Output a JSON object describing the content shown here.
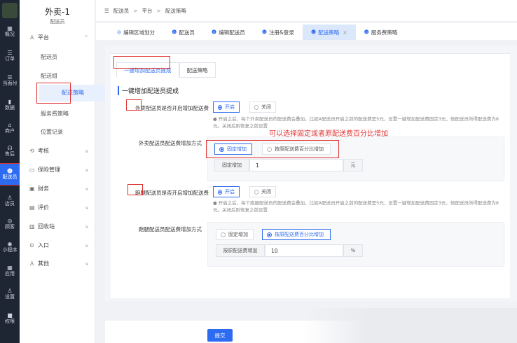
{
  "rail": {
    "items": [
      {
        "label": "概况",
        "icon": "▦"
      },
      {
        "label": "订单",
        "icon": "☰"
      },
      {
        "label": "当面付",
        "icon": "☰"
      },
      {
        "label": "数据",
        "icon": "▮"
      },
      {
        "label": "商户",
        "icon": "⌂"
      },
      {
        "label": "售后",
        "icon": "☊"
      },
      {
        "label": "配送员",
        "icon": "☻"
      },
      {
        "label": "店员",
        "icon": "♙"
      },
      {
        "label": "顾客",
        "icon": "◎"
      },
      {
        "label": "小程序",
        "icon": "◉"
      },
      {
        "label": "应用",
        "icon": "▦"
      },
      {
        "label": "设置",
        "icon": "♙"
      },
      {
        "label": "权限",
        "icon": "■"
      }
    ]
  },
  "sidebar": {
    "title": "外卖-1",
    "subtitle": "配送员",
    "groups": [
      {
        "label": "平台",
        "icon": "♙",
        "arrow": "^"
      },
      {
        "label": "考核",
        "icon": "⟲",
        "arrow": "v"
      },
      {
        "label": "保险管理",
        "icon": "▭",
        "arrow": "v"
      },
      {
        "label": "财务",
        "icon": "▣",
        "arrow": "v"
      },
      {
        "label": "评价",
        "icon": "▤",
        "arrow": "v"
      },
      {
        "label": "回收站",
        "icon": "▥",
        "arrow": "v"
      },
      {
        "label": "入口",
        "icon": "⊙",
        "arrow": "v"
      },
      {
        "label": "其他",
        "icon": "♙",
        "arrow": "v"
      }
    ],
    "subitems": [
      "配送员",
      "配送组",
      "配送策略",
      "服务费策略",
      "位置记录"
    ]
  },
  "breadcrumb": {
    "menu_icon": "☰",
    "items": [
      "配送员",
      "平台",
      "配送策略"
    ],
    "sep": ">"
  },
  "tabs": [
    {
      "label": "编辑区域划分",
      "icon": "◎"
    },
    {
      "label": "配送员",
      "icon": "☻"
    },
    {
      "label": "编辑配送员",
      "icon": "☻"
    },
    {
      "label": "注册&登录",
      "icon": "☻"
    },
    {
      "label": "配送策略",
      "icon": "☻",
      "close": "×"
    },
    {
      "label": "服务费策略",
      "icon": "☻"
    }
  ],
  "subtabs": [
    "一键增加配送员提成",
    "配送策略"
  ],
  "section_title": "一键增加配送员提成",
  "takeaway": {
    "enable_label": "外卖配送员是否开启增加配送费",
    "on": "开启",
    "off": "关闭",
    "hint": "开启之后，每个外卖配送员的配送费会叠加，比如A配送员开启之前的配送费是5元，设置一键增加配送费固定3元，他配送员所得配送费为8元。关闭后则恢复之前设置",
    "mode_label": "外卖配送员配送费增加方式",
    "mode_fixed": "固定增加",
    "mode_percent": "按原配送费百分比增加",
    "amount_label": "固定增加",
    "amount_value": "1",
    "amount_unit": "元"
  },
  "errand": {
    "enable_label": "跑腿配送员是否开启增加配送费",
    "on": "开启",
    "off": "关闭",
    "hint": "开启之后，每个跑腿配送员的配送费会叠加，比如A配送员开启之前的配送费是5元，设置一键增加配送费固定3元，他配送员所得配送费为8元。关闭后则恢复之前设置",
    "mode_label": "跑腿配送员配送费增加方式",
    "mode_fixed": "固定增加",
    "mode_percent": "按原配送费百分比增加",
    "amount_label": "按原配送费增加",
    "amount_value": "10",
    "amount_unit": "%"
  },
  "annotation": "可以选择固定或者原配送费百分比增加",
  "submit": "提交",
  "colors": {
    "accent": "#2d6cf0",
    "highlight": "#e03030",
    "rail": "#1f2633"
  }
}
